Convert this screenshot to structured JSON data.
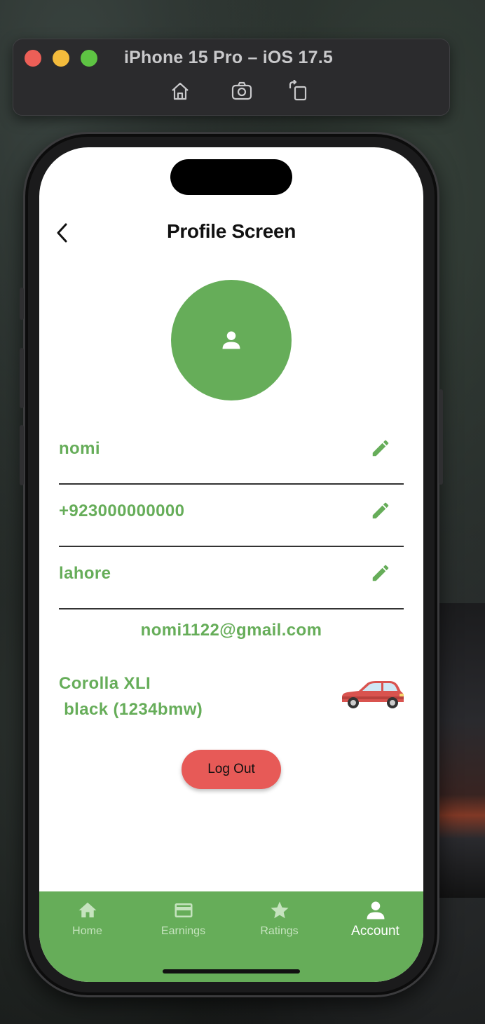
{
  "simulator": {
    "title": "iPhone 15 Pro – iOS 17.5",
    "tools": [
      "home-icon",
      "screenshot-icon",
      "rotate-icon"
    ]
  },
  "header": {
    "title": "Profile Screen",
    "back_icon": "chevron-left-icon"
  },
  "profile": {
    "avatar_icon": "person-icon",
    "fields": [
      {
        "value": "nomi",
        "icon": "pencil-icon"
      },
      {
        "value": "+923000000000",
        "icon": "pencil-icon"
      },
      {
        "value": "lahore",
        "icon": "pencil-icon"
      }
    ],
    "email": "nomi1122@gmail.com",
    "vehicle": {
      "model": "Corolla XLI",
      "details": " black (1234bmw)",
      "icon": "car-icon"
    },
    "logout_label": "Log Out"
  },
  "bottom_nav": {
    "items": [
      {
        "label": "Home",
        "icon": "home-icon",
        "active": false
      },
      {
        "label": "Earnings",
        "icon": "card-icon",
        "active": false
      },
      {
        "label": "Ratings",
        "icon": "star-icon",
        "active": false
      },
      {
        "label": "Account",
        "icon": "person-icon",
        "active": true
      }
    ]
  },
  "colors": {
    "primary_green": "#66ad59",
    "logout_red": "#e75a57"
  }
}
